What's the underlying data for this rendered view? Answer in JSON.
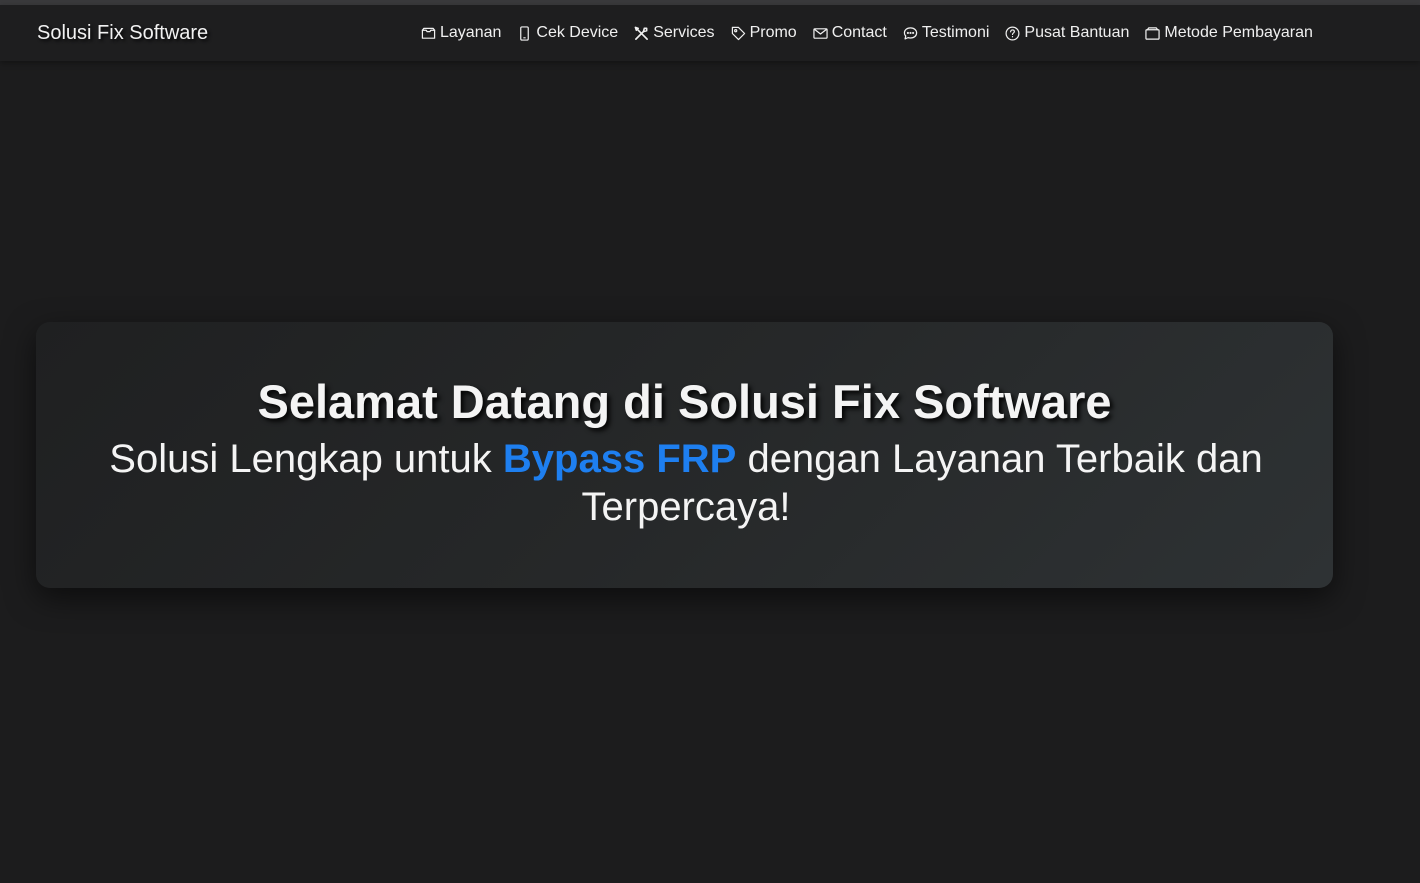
{
  "brand": {
    "name": "Solusi Fix Software"
  },
  "nav": {
    "items": [
      {
        "label": "Layanan",
        "icon": "inbox-icon"
      },
      {
        "label": "Cek Device",
        "icon": "phone-icon"
      },
      {
        "label": "Services",
        "icon": "tools-icon"
      },
      {
        "label": "Promo",
        "icon": "tag-icon"
      },
      {
        "label": "Contact",
        "icon": "envelope-icon"
      },
      {
        "label": "Testimoni",
        "icon": "chat-icon"
      },
      {
        "label": "Pusat Bantuan",
        "icon": "question-circle-icon"
      },
      {
        "label": "Metode Pembayaran",
        "icon": "wallet-icon"
      }
    ]
  },
  "hero": {
    "title": "Selamat Datang di Solusi Fix Software",
    "subtitle_before": "Solusi Lengkap untuk ",
    "subtitle_highlight": "Bypass FRP",
    "subtitle_after": " dengan Layanan Terbaik dan Terpercaya!"
  },
  "colors": {
    "background": "#1c1c1d",
    "navbar": "#1e1e1f",
    "accent": "#1e7ff0",
    "text": "#f4f4f4"
  }
}
